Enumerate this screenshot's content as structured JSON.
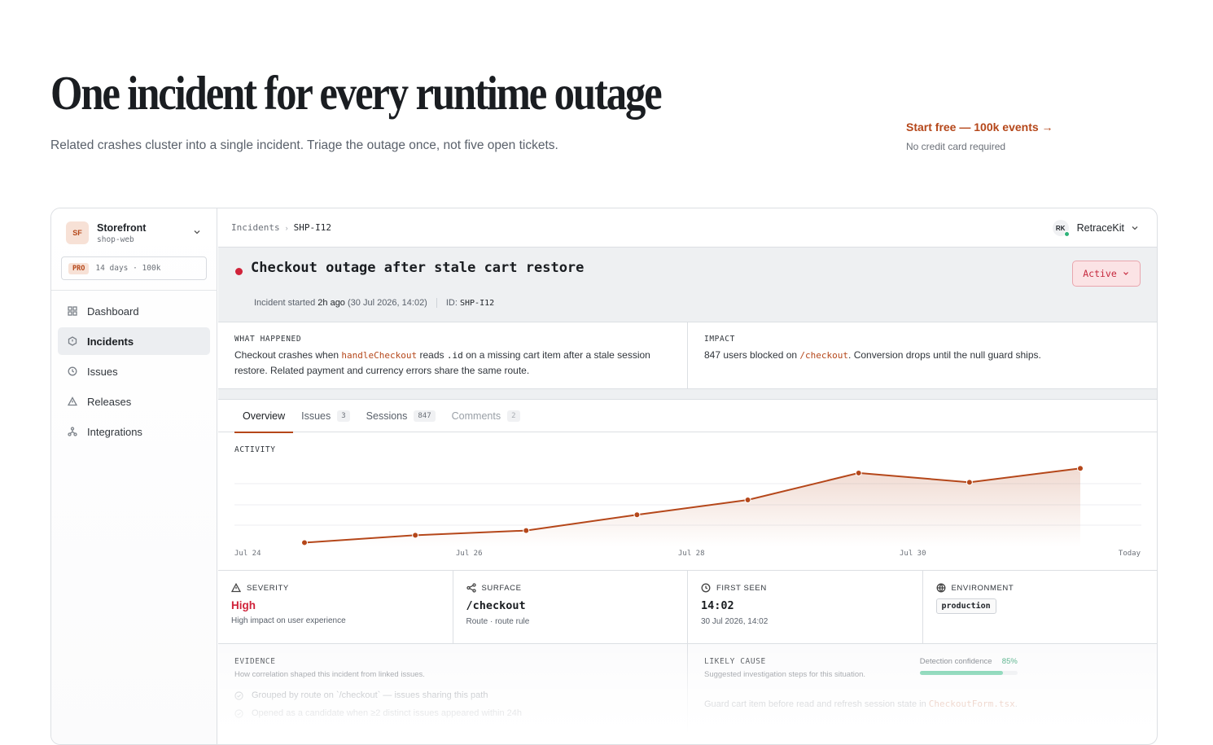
{
  "hero": {
    "title": "One incident for every runtime outage",
    "subtitle": "Related crashes cluster into a single incident. Triage the outage once, not five open tickets.",
    "cta": "Start free — 100k events",
    "cta_arrow": "→",
    "cta_note": "No credit card required"
  },
  "sidebar": {
    "workspace_initials": "SF",
    "workspace_name": "Storefront",
    "workspace_slug": "shop-web",
    "plan_badge": "PRO",
    "plan_info": "14 days · 100k",
    "items": [
      {
        "label": "Dashboard",
        "icon": "grid-icon"
      },
      {
        "label": "Incidents",
        "icon": "hexagon-icon",
        "active": true
      },
      {
        "label": "Issues",
        "icon": "clock-icon"
      },
      {
        "label": "Releases",
        "icon": "triangle-icon"
      },
      {
        "label": "Integrations",
        "icon": "nodes-icon"
      }
    ]
  },
  "topbar": {
    "crumb_root": "Incidents",
    "crumb_current": "SHP-I12",
    "user_initials": "RK",
    "user_name": "RetraceKit"
  },
  "incident": {
    "title": "Checkout outage after stale cart restore",
    "started_prefix": "Incident started",
    "started_rel": "2h ago",
    "started_abs": "(30 Jul 2026, 14:02)",
    "id_label": "ID:",
    "id": "SHP-I12",
    "status": "Active",
    "status_color": "#c6283d"
  },
  "what_happened": {
    "label": "WHAT HAPPENED",
    "p1": "Checkout crashes when",
    "code1": "handleCheckout",
    "p2": "reads",
    "code2": ".id",
    "p3": "on a missing cart item after a stale session restore. Related payment and currency errors share the same route."
  },
  "impact": {
    "label": "IMPACT",
    "p1": "847 users blocked on",
    "code": "/checkout",
    "p2": ". Conversion drops until the null guard ships."
  },
  "tabs": [
    {
      "label": "Overview",
      "count": ""
    },
    {
      "label": "Issues",
      "count": "3"
    },
    {
      "label": "Sessions",
      "count": "847"
    },
    {
      "label": "Comments",
      "count": "2"
    }
  ],
  "activity": {
    "label": "ACTIVITY"
  },
  "chart_data": {
    "type": "area",
    "title": "ACTIVITY",
    "x_ticks": [
      "Jul 24",
      "Jul 26",
      "Jul 28",
      "Jul 30",
      "Today"
    ],
    "x": [
      "Jul 24",
      "Jul 25",
      "Jul 26",
      "Jul 27",
      "Jul 28",
      "Jul 29",
      "Jul 30",
      "Jul 31"
    ],
    "values": [
      4,
      12,
      17,
      34,
      50,
      79,
      69,
      84
    ],
    "ylim": [
      0,
      100
    ],
    "grid": true,
    "color": "#b5471a"
  },
  "stats": [
    {
      "label": "SEVERITY",
      "icon": "warning-icon",
      "value": "High",
      "sub": "High impact on user experience"
    },
    {
      "label": "SURFACE",
      "icon": "share-icon",
      "value": "/checkout",
      "sub": "Route · route rule"
    },
    {
      "label": "FIRST SEEN",
      "icon": "clock-icon",
      "value": "14:02",
      "sub": "30 Jul 2026, 14:02"
    },
    {
      "label": "ENVIRONMENT",
      "icon": "globe-icon",
      "value": "production"
    }
  ],
  "evidence": {
    "label": "EVIDENCE",
    "sub": "How correlation shaped this incident from linked issues.",
    "items": [
      "Grouped by route on `/checkout` — issues sharing this path",
      "Opened as a candidate when ≥2 distinct issues appeared within 24h"
    ]
  },
  "likely_cause": {
    "label": "LIKELY CAUSE",
    "sub": "Suggested investigation steps for this situation.",
    "confidence_label": "Detection confidence",
    "confidence": "85%",
    "confidence_value": 0.85,
    "text": "Guard cart item before read and refresh session state in",
    "code": "CheckoutForm.tsx",
    "tail": "."
  }
}
